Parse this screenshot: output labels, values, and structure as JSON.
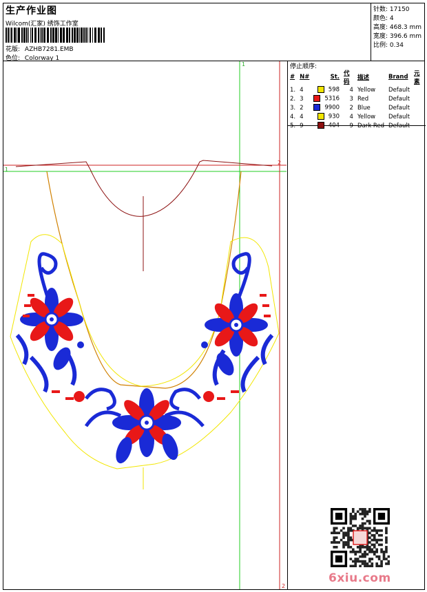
{
  "header": {
    "title": "生产作业图",
    "subtitle": "Wilcom(汇家) 绣饰工作室",
    "design_label": "花版:",
    "design_value": "AZHB7281.EMB",
    "colorway_label": "色位:",
    "colorway_value": "Colorway 1"
  },
  "stats": {
    "stitches": "针数: 17150",
    "colors": "颜色: 4",
    "height": "高度: 468.3 mm",
    "width": "宽度: 396.6 mm",
    "scale": "比例: 0.34"
  },
  "stop_sequence": {
    "title": "停止顺序:",
    "columns": [
      "#",
      "N#",
      "St.",
      "代码",
      "描述",
      "Brand",
      "元素"
    ],
    "rows": [
      {
        "idx": "1.",
        "needle": "4",
        "stitches": "598",
        "code": "4",
        "desc": "Yellow",
        "brand": "Default",
        "color": "#f2e600"
      },
      {
        "idx": "2.",
        "needle": "3",
        "stitches": "5316",
        "code": "3",
        "desc": "Red",
        "brand": "Default",
        "color": "#e81818"
      },
      {
        "idx": "3.",
        "needle": "2",
        "stitches": "9900",
        "code": "2",
        "desc": "Blue",
        "brand": "Default",
        "color": "#1a2ad6"
      },
      {
        "idx": "4.",
        "needle": "4",
        "stitches": "930",
        "code": "4",
        "desc": "Yellow",
        "brand": "Default",
        "color": "#f2e600"
      },
      {
        "idx": "5.",
        "needle": "9",
        "stitches": "404",
        "code": "9",
        "desc": "Dark Red",
        "brand": "Default",
        "color": "#8c1010"
      }
    ]
  },
  "guides": {
    "top_marker": "1",
    "right_marker_top": "2",
    "left_marker": "1",
    "right_marker_bottom": "2"
  },
  "watermark": "6xiu.com"
}
